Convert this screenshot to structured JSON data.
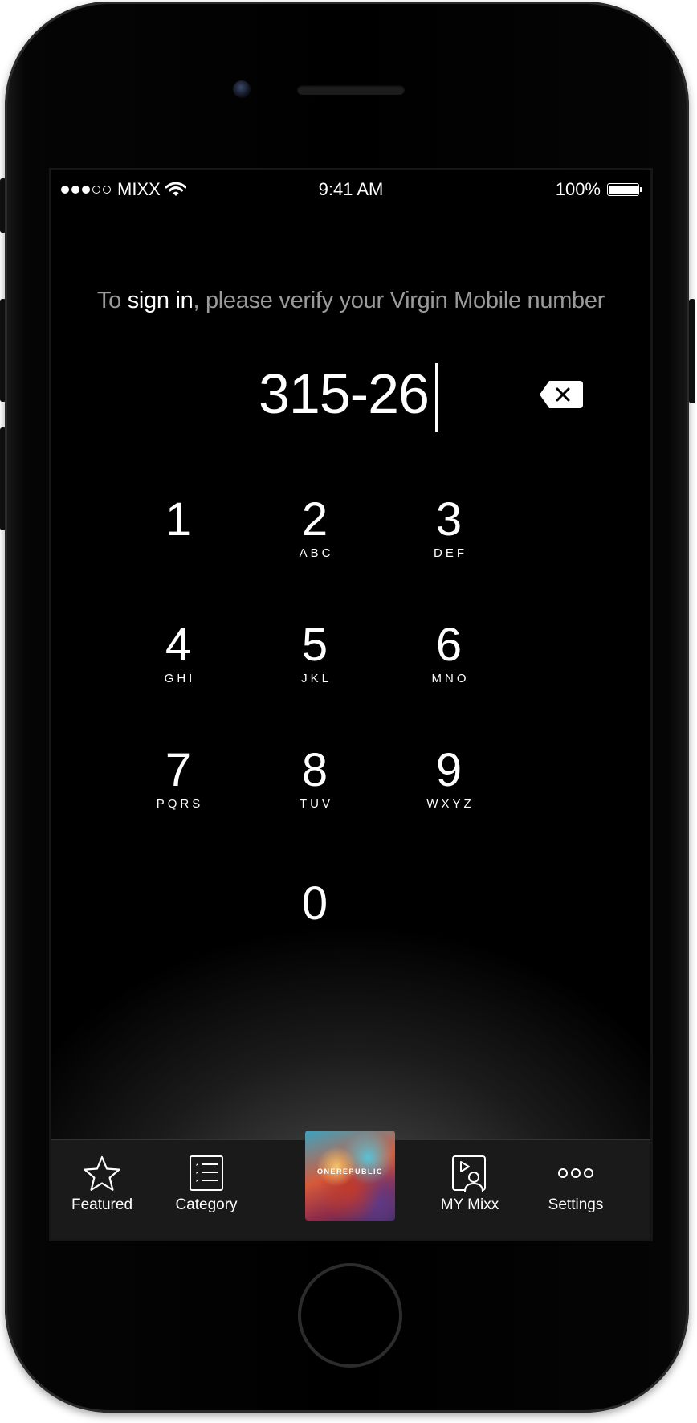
{
  "status_bar": {
    "signal_dots_filled": 3,
    "signal_dots_total": 5,
    "carrier": "MIXX",
    "time": "9:41 AM",
    "battery_percent": "100%",
    "battery_level": 1.0
  },
  "prompt": {
    "prefix": "To ",
    "emphasis": "sign in",
    "suffix": ", please verify your Virgin Mobile number"
  },
  "number_input": {
    "value": "315-26"
  },
  "keypad": {
    "keys": [
      {
        "digit": "1",
        "letters": ""
      },
      {
        "digit": "2",
        "letters": "ABC"
      },
      {
        "digit": "3",
        "letters": "DEF"
      },
      {
        "digit": "4",
        "letters": "GHI"
      },
      {
        "digit": "5",
        "letters": "JKL"
      },
      {
        "digit": "6",
        "letters": "MNO"
      },
      {
        "digit": "7",
        "letters": "PQRS"
      },
      {
        "digit": "8",
        "letters": "TUV"
      },
      {
        "digit": "9",
        "letters": "WXYZ"
      },
      {
        "digit": "0",
        "letters": ""
      }
    ]
  },
  "tab_bar": {
    "tabs": [
      {
        "label": "Featured",
        "icon": "star-icon"
      },
      {
        "label": "Category",
        "icon": "list-icon"
      },
      {
        "label": "",
        "icon": "album-art"
      },
      {
        "label": "MY Mixx",
        "icon": "my-mixx-icon"
      },
      {
        "label": "Settings",
        "icon": "more-icon"
      }
    ],
    "album_text": "ONEREPUBLIC"
  }
}
